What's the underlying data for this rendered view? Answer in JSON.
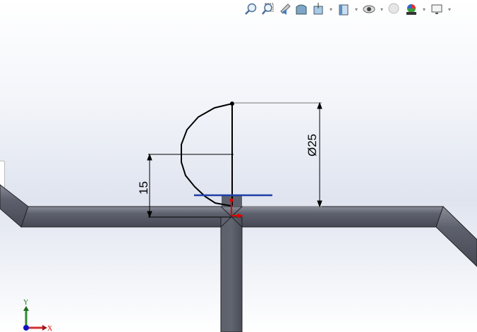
{
  "toolbar": {
    "items": [
      {
        "icon": "zoom-to-fit-icon"
      },
      {
        "icon": "zoom-to-area-icon"
      },
      {
        "icon": "previous-view-icon"
      },
      {
        "icon": "section-view-icon"
      },
      {
        "icon": "view-orientation-icon",
        "dropdown": "▾"
      },
      {
        "icon": "display-style-icon",
        "dropdown": "▾"
      },
      {
        "icon": "hide-show-items-icon",
        "dropdown": "▾"
      },
      {
        "icon": "edit-appearance-icon"
      },
      {
        "icon": "apply-scene-icon",
        "dropdown": "▾"
      },
      {
        "icon": "view-settings-icon",
        "dropdown": "▾"
      }
    ]
  },
  "sketch": {
    "dimensions": {
      "height": "15",
      "diameter": "Ø25"
    }
  },
  "triad": {
    "x_label": "X",
    "y_label": "Y"
  },
  "colors": {
    "pipe": "#5b5f6b",
    "selected_line": "#1f3fa8",
    "origin": "#e00000"
  }
}
